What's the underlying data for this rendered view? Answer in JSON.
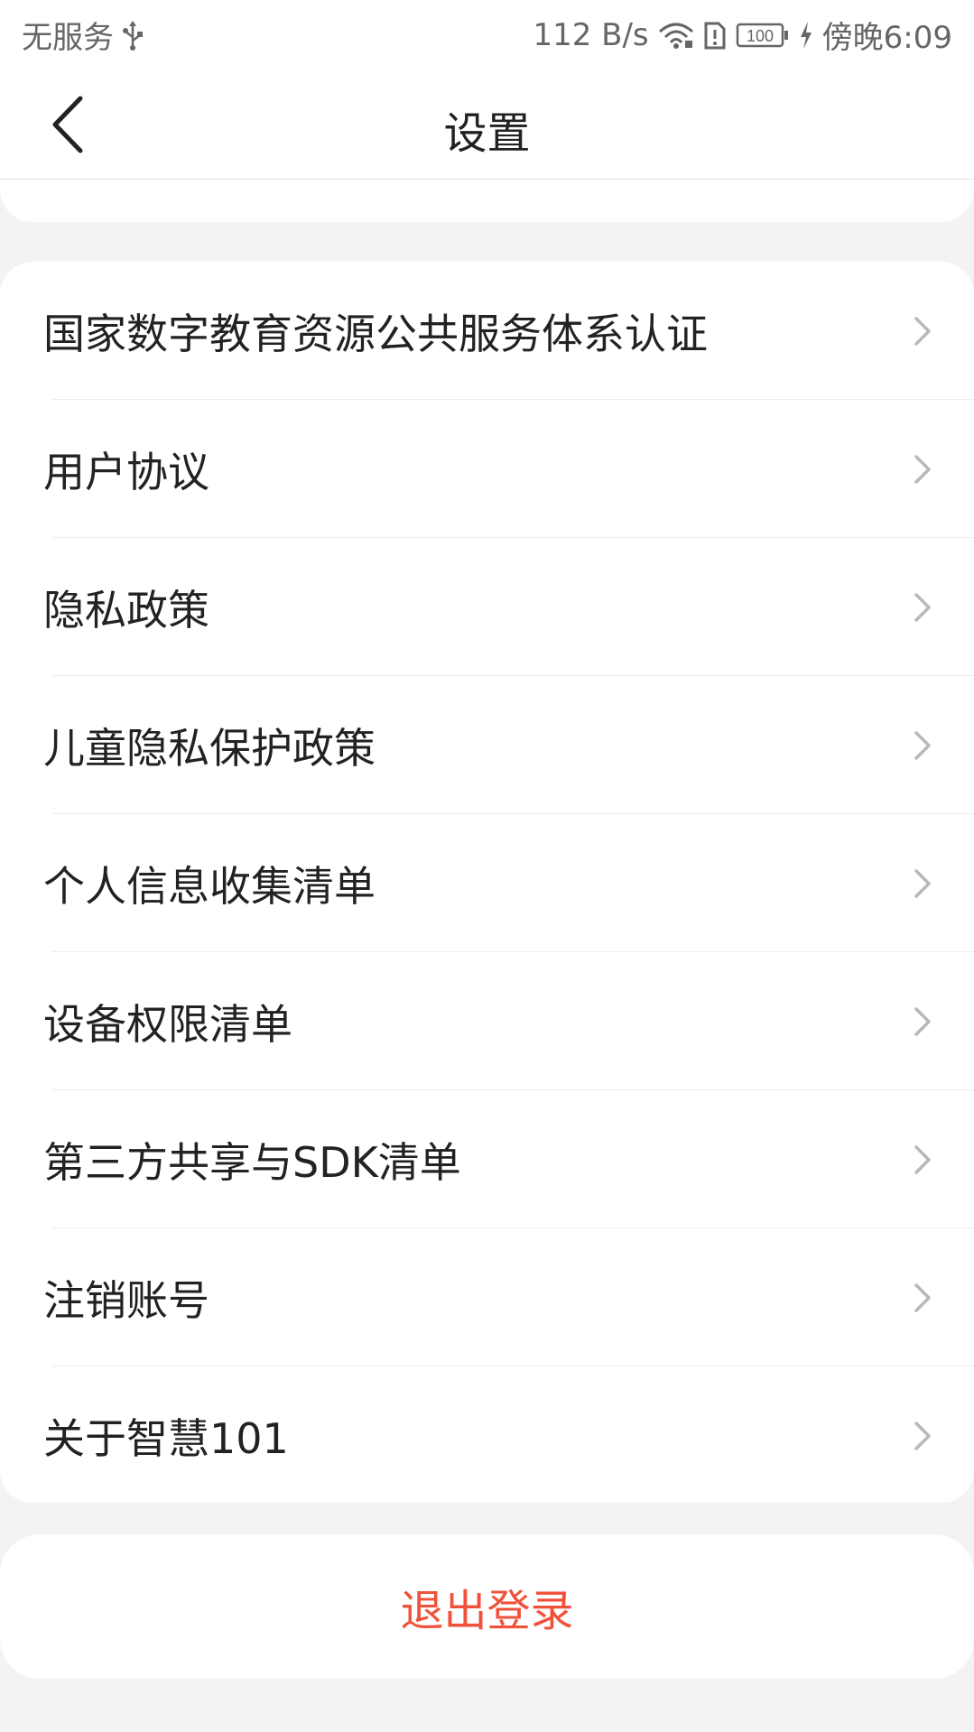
{
  "status_bar": {
    "carrier": "无服务",
    "usb_icon": "usb-icon",
    "net_speed": "112 B/s",
    "wifi_icon": "wifi-icon",
    "alert_icon": "alert-icon",
    "battery_level": "100",
    "charging_icon": "bolt-icon",
    "time": "傍晚6:09"
  },
  "header": {
    "back_icon": "chevron-left-icon",
    "title": "设置"
  },
  "menu": {
    "items": [
      {
        "label": "国家数字教育资源公共服务体系认证"
      },
      {
        "label": "用户协议"
      },
      {
        "label": "隐私政策"
      },
      {
        "label": "儿童隐私保护政策"
      },
      {
        "label": "个人信息收集清单"
      },
      {
        "label": "设备权限清单"
      },
      {
        "label": "第三方共享与SDK清单"
      },
      {
        "label": "注销账号"
      },
      {
        "label": "关于智慧101"
      }
    ]
  },
  "logout": {
    "label": "退出登录"
  },
  "colors": {
    "background": "#f3f3f5",
    "card": "#ffffff",
    "logout_text": "#f0513a",
    "chevron": "#b8b8b8"
  }
}
